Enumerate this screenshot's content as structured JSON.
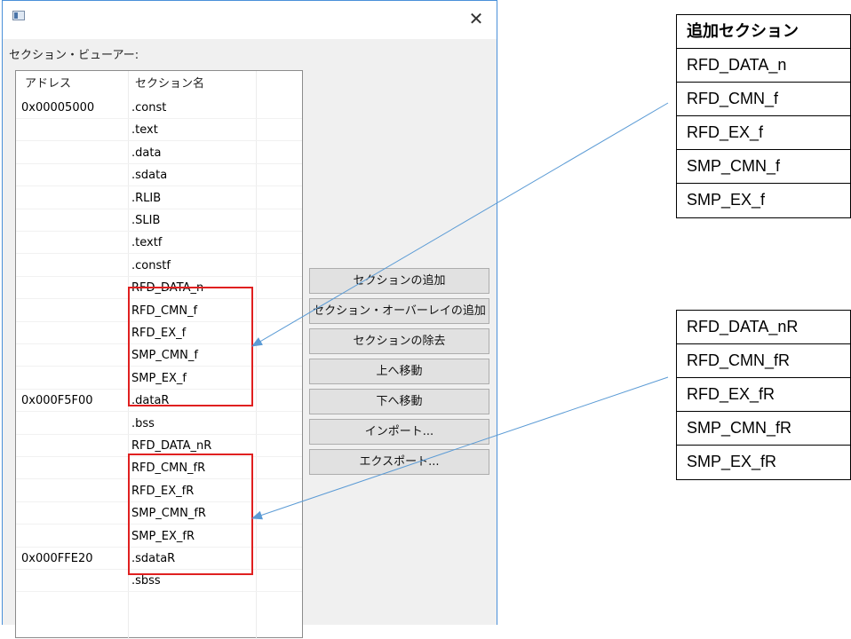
{
  "window": {
    "title": "",
    "viewer_label": "セクション・ビューアー:",
    "close_symbol": "✕"
  },
  "listview": {
    "columns": [
      "アドレス",
      "セクション名"
    ],
    "rows": [
      {
        "address": "0x00005000",
        "section": ".const"
      },
      {
        "address": "",
        "section": ".text"
      },
      {
        "address": "",
        "section": ".data"
      },
      {
        "address": "",
        "section": ".sdata"
      },
      {
        "address": "",
        "section": ".RLIB"
      },
      {
        "address": "",
        "section": ".SLIB"
      },
      {
        "address": "",
        "section": ".textf"
      },
      {
        "address": "",
        "section": ".constf"
      },
      {
        "address": "",
        "section": "RFD_DATA_n"
      },
      {
        "address": "",
        "section": "RFD_CMN_f"
      },
      {
        "address": "",
        "section": "RFD_EX_f"
      },
      {
        "address": "",
        "section": "SMP_CMN_f"
      },
      {
        "address": "",
        "section": "SMP_EX_f"
      },
      {
        "address": "0x000F5F00",
        "section": ".dataR"
      },
      {
        "address": "",
        "section": ".bss"
      },
      {
        "address": "",
        "section": "RFD_DATA_nR"
      },
      {
        "address": "",
        "section": "RFD_CMN_fR"
      },
      {
        "address": "",
        "section": "RFD_EX_fR"
      },
      {
        "address": "",
        "section": "SMP_CMN_fR"
      },
      {
        "address": "",
        "section": "SMP_EX_fR"
      },
      {
        "address": "0x000FFE20",
        "section": ".sdataR"
      },
      {
        "address": "",
        "section": ".sbss"
      }
    ]
  },
  "buttons": {
    "add_section": "セクションの追加",
    "add_overlay": "セクション・オーバーレイの追加",
    "remove_section": "セクションの除去",
    "move_up": "上へ移動",
    "move_down": "下へ移動",
    "import": "インポート...",
    "export": "エクスポート..."
  },
  "annotation": {
    "table1": {
      "header": "追加セクション",
      "rows": [
        "RFD_DATA_n",
        "RFD_CMN_f",
        "RFD_EX_f",
        "SMP_CMN_f",
        "SMP_EX_f"
      ]
    },
    "table2": {
      "rows": [
        "RFD_DATA_nR",
        "RFD_CMN_fR",
        "RFD_EX_fR",
        "SMP_CMN_fR",
        "SMP_EX_fR"
      ]
    },
    "highlight_color": "#e02020",
    "arrow_color": "#5b9bd5"
  }
}
